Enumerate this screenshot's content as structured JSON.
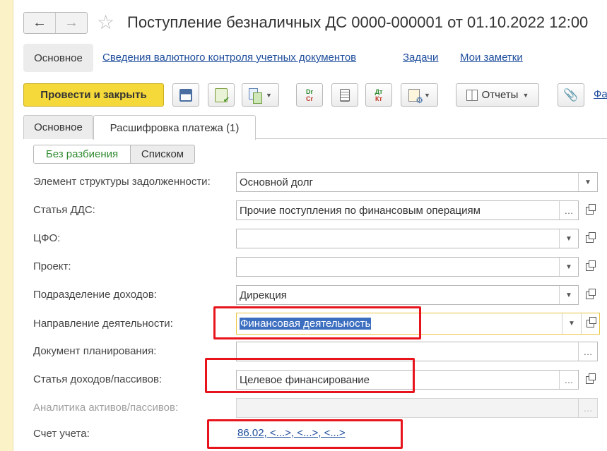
{
  "window": {
    "title": "Поступление безналичных ДС 0000-000001 от 01.10.2022 12:00",
    "back_icon": "arrow-left-icon",
    "forward_icon": "arrow-right-icon",
    "favorite_icon": "star-icon"
  },
  "sections": {
    "main_label": "Основное",
    "links": [
      "Сведения валютного контроля учетных документов",
      "Задачи",
      "Мои заметки"
    ]
  },
  "toolbar": {
    "post_and_close": "Провести и закрыть",
    "drcr_top": "Dr",
    "drcr_bottom": "Cr",
    "dtkt_top": "Дт",
    "dtkt_bottom": "Кт",
    "reports": "Отчеты",
    "more_link": "Фа"
  },
  "tabs": [
    "Основное",
    "Расшифровка платежа (1)"
  ],
  "view_mode": {
    "options": [
      "Без разбиения",
      "Списком"
    ],
    "selected": "Без разбиения"
  },
  "form": {
    "debt_structure": {
      "label": "Элемент структуры задолженности:",
      "value": "Основной долг"
    },
    "cash_flow_item": {
      "label": "Статья ДДС:",
      "value": "Прочие поступления по финансовым операциям"
    },
    "cfo": {
      "label": "ЦФО:",
      "value": ""
    },
    "project": {
      "label": "Проект:",
      "value": ""
    },
    "income_department": {
      "label": "Подразделение доходов:",
      "value": "Дирекция"
    },
    "activity_direction": {
      "label": "Направление деятельности:",
      "value": "Финансовая деятельность"
    },
    "planning_document": {
      "label": "Документ планирования:",
      "value": ""
    },
    "income_liability_item": {
      "label": "Статья доходов/пассивов:",
      "value": "Целевое финансирование"
    },
    "asset_liability_analytics": {
      "label": "Аналитика активов/пассивов:",
      "value": ""
    },
    "account": {
      "label": "Счет учета:",
      "value": "86.02, <...>, <...>, <...>"
    }
  },
  "colors": {
    "primary_button": "#f5d83a",
    "link": "#1f4e9c",
    "highlight_box": "#e8141c",
    "selection": "#3d6fc0"
  }
}
